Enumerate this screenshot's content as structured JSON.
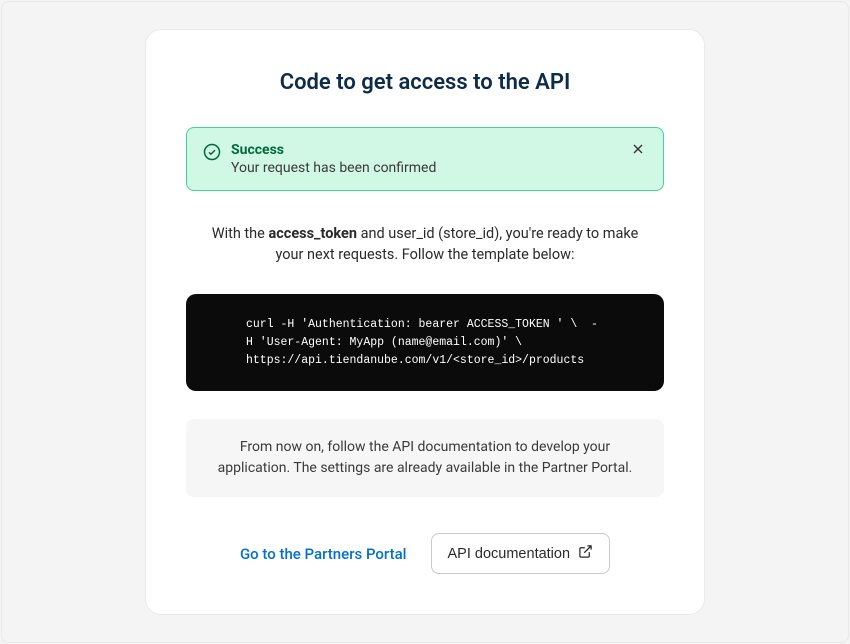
{
  "title": "Code to get access to the API",
  "alert": {
    "title": "Success",
    "message": "Your request has been confirmed"
  },
  "description_prefix": "With the ",
  "description_bold": "access_token",
  "description_suffix": " and user_id (store_id), you're ready to make your next requests. Follow the template below:",
  "code": "curl -H 'Authentication: bearer ACCESS_TOKEN ' \\  -H 'User-Agent: MyApp (name@email.com)' \\  https://api.tiendanube.com/v1/<store_id>/products",
  "info": "From now on, follow the API documentation to develop your application. The settings are already available in the Partner Portal.",
  "actions": {
    "partners_portal": "Go to the Partners Portal",
    "api_docs": "API documentation"
  }
}
